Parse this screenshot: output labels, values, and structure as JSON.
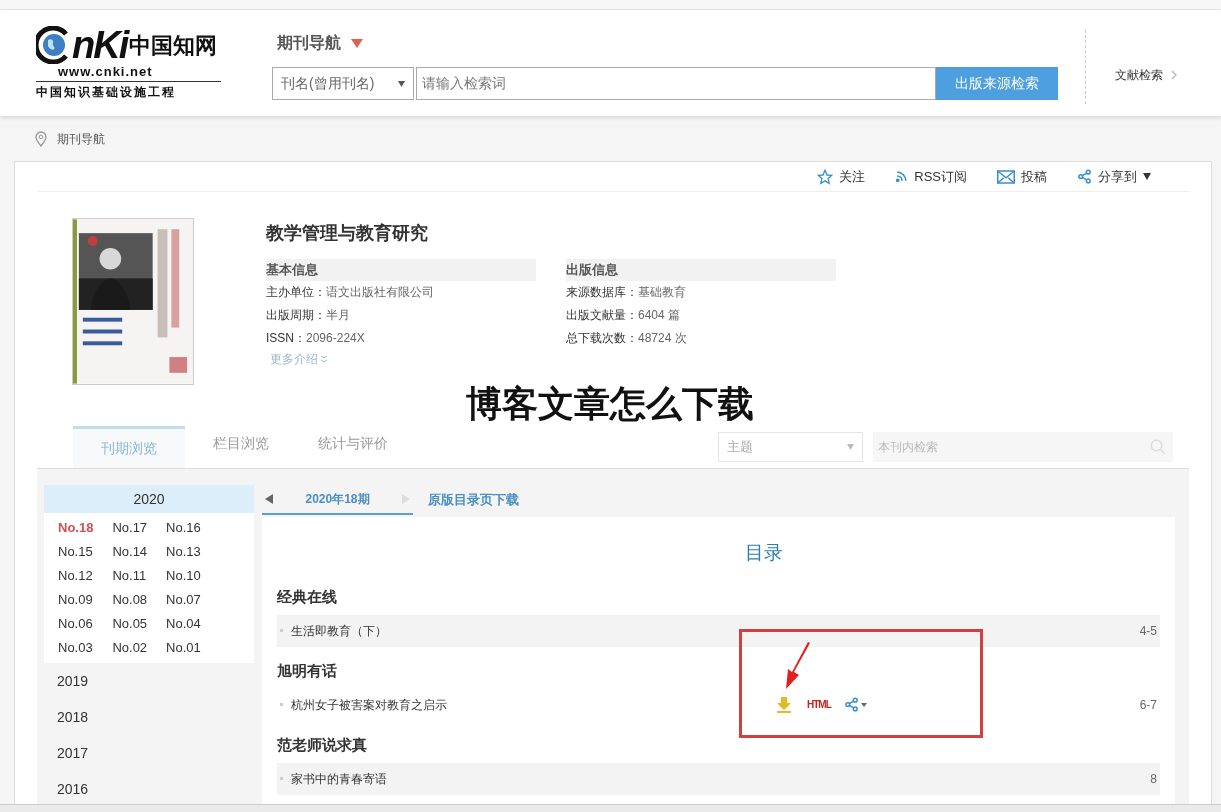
{
  "header": {
    "logo": {
      "letters": "nKi",
      "brand_cn": "中国知网",
      "domain": "www.cnki.net",
      "tagline": "中国知识基础设施工程"
    },
    "nav_title": "期刊导航",
    "search": {
      "field": "刊名(曾用刊名)",
      "placeholder": "请输入检索词",
      "button": "出版来源检索"
    },
    "side_link": "文献检索"
  },
  "breadcrumb": "期刊导航",
  "actions": [
    {
      "kind": "star",
      "label": "关注"
    },
    {
      "kind": "rss",
      "label": "RSS订阅"
    },
    {
      "kind": "mail",
      "label": "投稿"
    },
    {
      "kind": "share",
      "label": "分享到"
    }
  ],
  "journal": {
    "title": "教学管理与教育研究",
    "more": "更多介绍",
    "columns": [
      {
        "heading": "基本信息",
        "fields": [
          {
            "label": "主办单位：",
            "value": "语文出版社有限公司"
          },
          {
            "label": "出版周期：",
            "value": "半月"
          },
          {
            "label": "ISSN：",
            "value": "2096-224X"
          }
        ]
      },
      {
        "heading": "出版信息",
        "fields": [
          {
            "label": "来源数据库：",
            "value": "基础教育"
          },
          {
            "label": "出版文献量：",
            "value": "6404 篇"
          },
          {
            "label": "总下载次数：",
            "value": "48724 次"
          }
        ]
      }
    ]
  },
  "overlay_title": "博客文章怎么下载",
  "tabs": [
    {
      "label": "刊期浏览",
      "selected": true
    },
    {
      "label": "栏目浏览",
      "selected": false
    },
    {
      "label": "统计与评价",
      "selected": false
    }
  ],
  "filter": {
    "field": "主题",
    "placeholder": "本刊内检索"
  },
  "years": [
    {
      "year": "2020",
      "expanded": true,
      "issues": [
        {
          "label": "No.18",
          "selected": true
        },
        {
          "label": "No.17",
          "selected": false
        },
        {
          "label": "No.16",
          "selected": false
        },
        {
          "label": "No.15",
          "selected": false
        },
        {
          "label": "No.14",
          "selected": false
        },
        {
          "label": "No.13",
          "selected": false
        },
        {
          "label": "No.12",
          "selected": false
        },
        {
          "label": "No.11",
          "selected": false
        },
        {
          "label": "No.10",
          "selected": false
        },
        {
          "label": "No.09",
          "selected": false
        },
        {
          "label": "No.08",
          "selected": false
        },
        {
          "label": "No.07",
          "selected": false
        },
        {
          "label": "No.06",
          "selected": false
        },
        {
          "label": "No.05",
          "selected": false
        },
        {
          "label": "No.04",
          "selected": false
        },
        {
          "label": "No.03",
          "selected": false
        },
        {
          "label": "No.02",
          "selected": false
        },
        {
          "label": "No.01",
          "selected": false
        }
      ]
    },
    {
      "year": "2019",
      "expanded": false
    },
    {
      "year": "2018",
      "expanded": false
    },
    {
      "year": "2017",
      "expanded": false
    },
    {
      "year": "2016",
      "expanded": false
    }
  ],
  "issue_nav": {
    "current": "2020年18期",
    "download": "原版目录页下载"
  },
  "toc": {
    "title": "目录",
    "sections": [
      {
        "title": "经典在线",
        "articles": [
          {
            "title": "生活即教育（下）",
            "pages": "4-5",
            "highlighted": true,
            "tools_visible": false
          }
        ]
      },
      {
        "title": "旭明有话",
        "articles": [
          {
            "title": "杭州女子被害案对教育之启示",
            "pages": "6-7",
            "highlighted": false,
            "tools_visible": true,
            "html_label": "HTML"
          }
        ]
      },
      {
        "title": "范老师说求真",
        "articles": [
          {
            "title": "家书中的青春寄语",
            "pages": "8",
            "highlighted": true,
            "tools_visible": false
          }
        ]
      }
    ]
  }
}
